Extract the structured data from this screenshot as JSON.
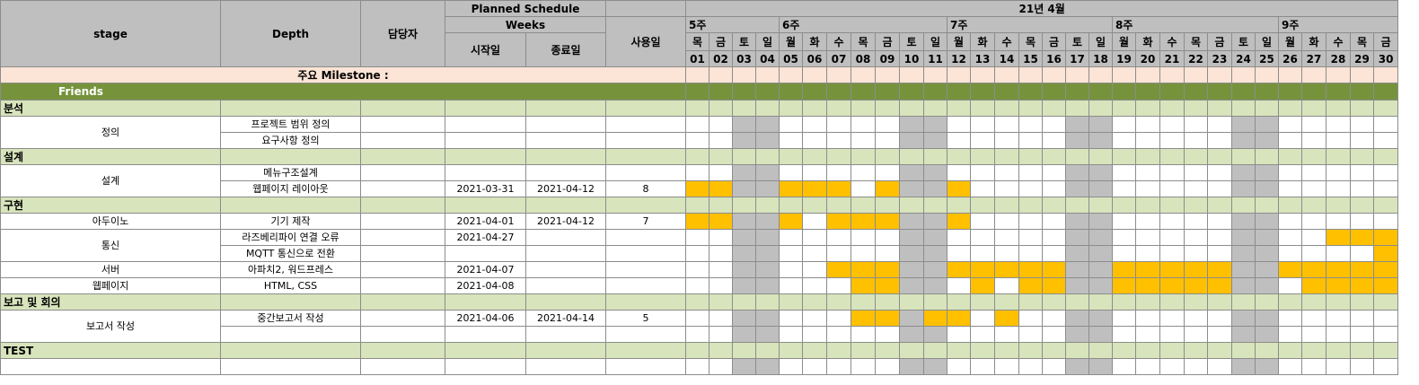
{
  "header": {
    "stage": "stage",
    "depth": "Depth",
    "owner": "담당자",
    "planned_schedule": "Planned Schedule",
    "weeks": "Weeks",
    "start": "시작일",
    "end": "종료일",
    "days_used": "사용일",
    "month": "21년 4월"
  },
  "week_labels": [
    "5주",
    "6주",
    "7주",
    "8주",
    "9주"
  ],
  "dows": [
    "목",
    "금",
    "토",
    "일",
    "월",
    "화",
    "수",
    "목",
    "금",
    "토",
    "일",
    "월",
    "화",
    "수",
    "목",
    "금",
    "토",
    "일",
    "월",
    "화",
    "수",
    "목",
    "금",
    "토",
    "일",
    "월",
    "화",
    "수",
    "목",
    "금"
  ],
  "dates": [
    "01",
    "02",
    "03",
    "04",
    "05",
    "06",
    "07",
    "08",
    "09",
    "10",
    "11",
    "12",
    "13",
    "14",
    "15",
    "16",
    "17",
    "18",
    "19",
    "20",
    "21",
    "22",
    "23",
    "24",
    "25",
    "26",
    "27",
    "28",
    "29",
    "30"
  ],
  "milestone": "주요 Milestone :",
  "group": "Friends",
  "sections": [
    {
      "title": "분석",
      "groups": [
        {
          "stage": "정의",
          "rows": [
            {
              "depth": "프로젝트 범위 정의",
              "start": "",
              "end": "",
              "days": "",
              "bars": []
            },
            {
              "depth": "요구사항 정의",
              "start": "",
              "end": "",
              "days": "",
              "bars": []
            }
          ]
        }
      ]
    },
    {
      "title": "설계",
      "groups": [
        {
          "stage": "설계",
          "rows": [
            {
              "depth": "메뉴구조설계",
              "start": "",
              "end": "",
              "days": "",
              "bars": []
            },
            {
              "depth": "웹페이지 레이아웃",
              "start": "2021-03-31",
              "end": "2021-04-12",
              "days": "8",
              "bars": [
                1,
                2,
                5,
                6,
                7,
                9,
                12
              ]
            }
          ]
        }
      ]
    },
    {
      "title": "구현",
      "groups": [
        {
          "stage": "아두이노",
          "rows": [
            {
              "depth": "기기 제작",
              "start": "2021-04-01",
              "end": "2021-04-12",
              "days": "7",
              "bars": [
                1,
                2,
                5,
                7,
                8,
                9,
                12
              ]
            }
          ]
        },
        {
          "stage": "통신",
          "rows": [
            {
              "depth": "라즈베리파이 연결 오류",
              "start": "2021-04-27",
              "end": "",
              "days": "",
              "bars": [
                28,
                29,
                30
              ]
            },
            {
              "depth": "MQTT 통신으로 전환",
              "start": "",
              "end": "",
              "days": "",
              "bars": [
                30
              ]
            }
          ]
        },
        {
          "stage": "서버",
          "rows": [
            {
              "depth": "아파치2, 워드프레스",
              "start": "2021-04-07",
              "end": "",
              "days": "",
              "bars": [
                7,
                8,
                9,
                12,
                13,
                14,
                15,
                16,
                19,
                20,
                21,
                22,
                23,
                26,
                27,
                28,
                29,
                30
              ]
            }
          ]
        },
        {
          "stage": "웹페이지",
          "rows": [
            {
              "depth": "HTML, CSS",
              "start": "2021-04-08",
              "end": "",
              "days": "",
              "bars": [
                8,
                9,
                13,
                15,
                16,
                19,
                20,
                21,
                22,
                23,
                27,
                28,
                29,
                30
              ]
            }
          ]
        }
      ]
    },
    {
      "title": "보고 및 회의",
      "groups": [
        {
          "stage": "보고서 작성",
          "rows": [
            {
              "depth": "중간보고서 작성",
              "start": "2021-04-06",
              "end": "2021-04-14",
              "days": "5",
              "bars": [
                8,
                9,
                11,
                12,
                14
              ]
            },
            {
              "depth": "",
              "start": "",
              "end": "",
              "days": "",
              "bars": []
            }
          ]
        }
      ]
    },
    {
      "title": "TEST",
      "groups": [
        {
          "stage": "",
          "rows": [
            {
              "depth": "",
              "start": "",
              "end": "",
              "days": "",
              "bars": []
            }
          ]
        }
      ]
    }
  ],
  "colors": {
    "header_gray": "#bfbfbf",
    "milestone": "#fce4d6",
    "friends": "#76933c",
    "section": "#d8e4bc",
    "weekend": "#bfbfbf",
    "bar": "#ffc000"
  }
}
